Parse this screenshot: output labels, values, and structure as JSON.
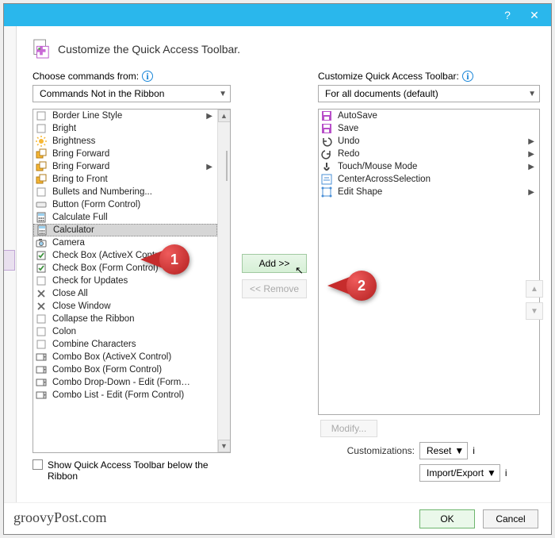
{
  "title": "Customize the Quick Access Toolbar.",
  "left": {
    "label": "Choose commands from:",
    "comboValue": "Commands Not in the Ribbon",
    "items": [
      {
        "label": "Border Line Style",
        "sub": true
      },
      {
        "label": "Bright"
      },
      {
        "label": "Brightness"
      },
      {
        "label": "Bring Forward"
      },
      {
        "label": "Bring Forward",
        "sub": true
      },
      {
        "label": "Bring to Front"
      },
      {
        "label": "Bullets and Numbering..."
      },
      {
        "label": "Button (Form Control)"
      },
      {
        "label": "Calculate Full"
      },
      {
        "label": "Calculator",
        "selected": true
      },
      {
        "label": "Camera"
      },
      {
        "label": "Check Box (ActiveX Control)"
      },
      {
        "label": "Check Box (Form Control)"
      },
      {
        "label": "Check for Updates"
      },
      {
        "label": "Close All"
      },
      {
        "label": "Close Window"
      },
      {
        "label": "Collapse the Ribbon"
      },
      {
        "label": "Colon"
      },
      {
        "label": "Combine Characters"
      },
      {
        "label": "Combo Box (ActiveX Control)"
      },
      {
        "label": "Combo Box (Form Control)"
      },
      {
        "label": "Combo Drop-Down - Edit (Form…"
      },
      {
        "label": "Combo List - Edit (Form Control)"
      }
    ],
    "showBelow": "Show Quick Access Toolbar below the Ribbon"
  },
  "mid": {
    "add": "Add >>",
    "remove": "<< Remove"
  },
  "right": {
    "label": "Customize Quick Access Toolbar:",
    "comboValue": "For all documents (default)",
    "items": [
      {
        "label": "AutoSave"
      },
      {
        "label": "Save"
      },
      {
        "label": "Undo",
        "sub": true
      },
      {
        "label": "Redo",
        "sub": true
      },
      {
        "label": "Touch/Mouse Mode",
        "sub": true
      },
      {
        "label": "CenterAcrossSelection"
      },
      {
        "label": "Edit Shape",
        "sub": true
      }
    ],
    "modify": "Modify...",
    "customizationsLabel": "Customizations:",
    "reset": "Reset",
    "importExport": "Import/Export"
  },
  "footer": {
    "ok": "OK",
    "cancel": "Cancel"
  },
  "callouts": {
    "c1": "1",
    "c2": "2"
  },
  "watermark": "groovyPost.com"
}
